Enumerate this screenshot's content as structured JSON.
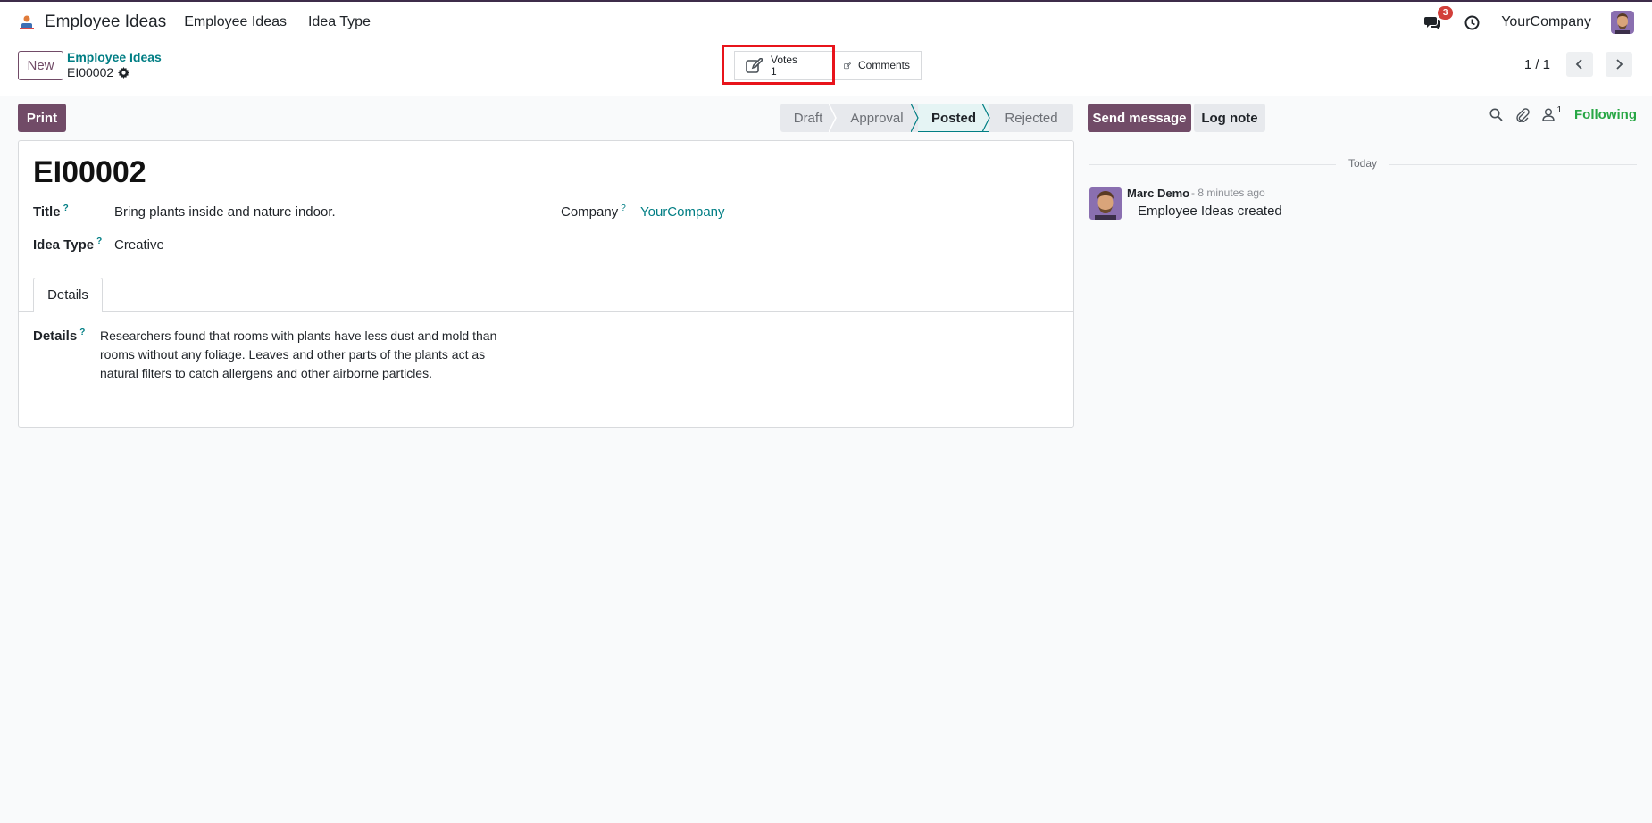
{
  "navbar": {
    "brand": "Employee Ideas",
    "menu_items": [
      "Employee Ideas",
      "Idea Type"
    ],
    "messages_badge": "3",
    "company": "YourCompany"
  },
  "control_panel": {
    "new_label": "New",
    "breadcrumb_parent": "Employee Ideas",
    "breadcrumb_current": "EI00002",
    "smart_buttons": {
      "votes_label": "Votes",
      "votes_count": "1",
      "comments_label": "Comments"
    },
    "pager": "1 / 1"
  },
  "actions": {
    "print_label": "Print",
    "send_message_label": "Send message",
    "log_note_label": "Log note",
    "followers_count": "1",
    "following_label": "Following"
  },
  "statusbar": {
    "stages": [
      "Draft",
      "Approval",
      "Posted",
      "Rejected"
    ],
    "active": "Posted"
  },
  "form": {
    "record_name": "EI00002",
    "title_label": "Title",
    "title_value": "Bring plants inside and nature indoor.",
    "idea_type_label": "Idea Type",
    "idea_type_value": "Creative",
    "company_label": "Company",
    "company_value": "YourCompany",
    "help_mark": "?",
    "tab_details": "Details",
    "details_label": "Details",
    "details_value": "Researchers found that rooms with plants have less dust and mold than rooms without any foliage. Leaves and other parts of the plants act as natural filters to catch allergens and other airborne particles."
  },
  "chatter": {
    "divider": "Today",
    "messages": [
      {
        "author": "Marc Demo",
        "time": "- 8 minutes ago",
        "body": "Employee Ideas created"
      }
    ]
  },
  "colors": {
    "primary": "#714b67",
    "link": "#017e84",
    "following": "#28a745",
    "highlight": "#e8141b"
  }
}
